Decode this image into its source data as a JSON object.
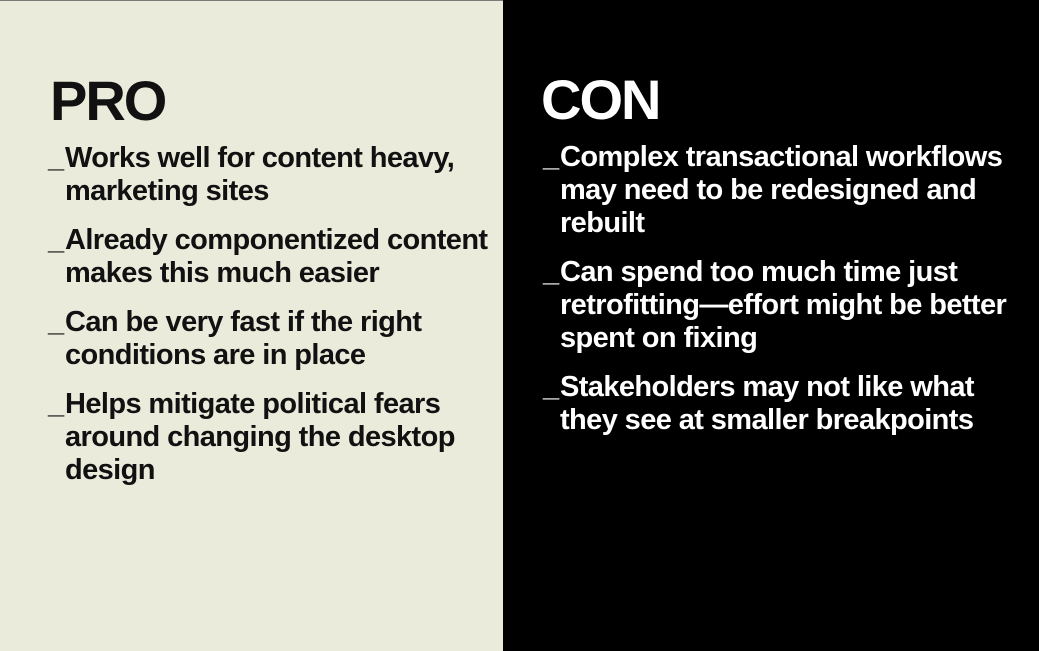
{
  "pro": {
    "heading": "PRO",
    "bullet": "_",
    "items": [
      "Works well for content heavy, marketing sites",
      "Already componentized content makes this much easier",
      "Can be very fast if the right conditions are in place",
      "Helps mitigate political fears around changing the desktop design"
    ]
  },
  "con": {
    "heading": "CON",
    "bullet": "_",
    "items": [
      "Complex transactional workflows may need to be redesigned and rebuilt",
      "Can spend too much time just retrofitting—effort might be better spent on fixing",
      "Stakeholders may not like what they see at smaller breakpoints"
    ]
  },
  "colors": {
    "pro_background": "#ebebdc",
    "con_background": "#000000",
    "pro_text": "#111111",
    "con_text": "#ffffff"
  }
}
